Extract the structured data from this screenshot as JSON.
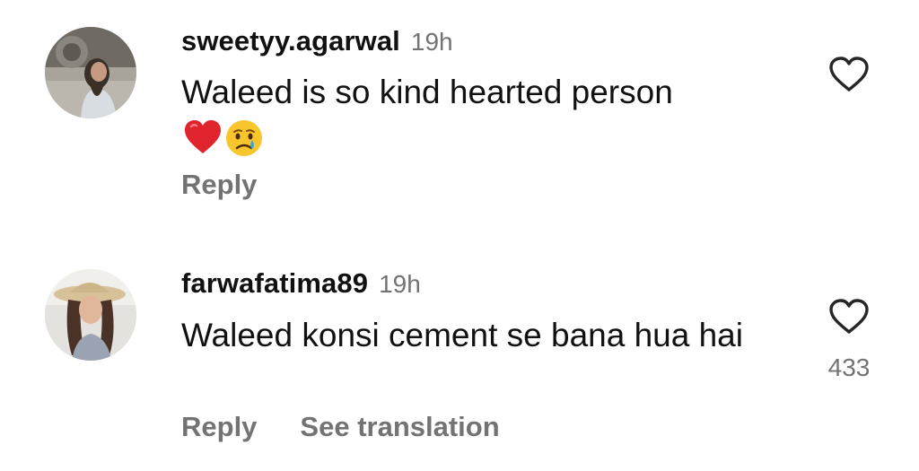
{
  "colors": {
    "text_primary": "#111111",
    "text_secondary": "#737373",
    "background": "#ffffff"
  },
  "comments": [
    {
      "username": "sweetyy.agarwal",
      "timestamp": "19h",
      "text": "Waleed is so kind hearted person",
      "emojis": [
        "red-heart-icon",
        "crying-face-icon"
      ],
      "actions": [
        "Reply"
      ],
      "like_icon": "heart-outline-icon",
      "like_count": ""
    },
    {
      "username": "farwafatima89",
      "timestamp": "19h",
      "text": "Waleed konsi cement se bana hua hai",
      "emojis": [],
      "actions": [
        "Reply",
        "See translation"
      ],
      "like_icon": "heart-outline-icon",
      "like_count": "433"
    }
  ]
}
